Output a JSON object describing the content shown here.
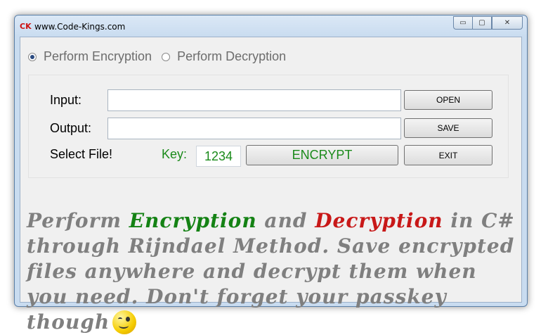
{
  "window": {
    "app_icon_text": "CK",
    "title": "www.Code-Kings.com",
    "controls": {
      "minimize": "▭",
      "maximize": "▢",
      "close": "✕"
    }
  },
  "mode": {
    "encrypt_label": "Perform Encryption",
    "decrypt_label": "Perform Decryption",
    "selected": "encrypt"
  },
  "form": {
    "input_label": "Input:",
    "input_value": "",
    "output_label": "Output:",
    "output_value": "",
    "select_file_label": "Select File!",
    "key_label": "Key:",
    "key_value": "1234",
    "open_button": "OPEN",
    "save_button": "SAVE",
    "encrypt_button": "ENCRYPT",
    "exit_button": "EXIT"
  },
  "promo": {
    "part1": "Perform ",
    "encryption_word": "Encryption",
    "part2": " and ",
    "decryption_word": "Decryption",
    "part3": " in C# through Rijndael Method. Save encrypted files anywhere and decrypt them when you need. Don't forget your passkey though",
    "emoji": "wink-smiley"
  },
  "colors": {
    "green": "#1a8a1a",
    "red": "#c81818",
    "gray_text": "#7f7f7f",
    "title_icon": "#cc1111"
  }
}
